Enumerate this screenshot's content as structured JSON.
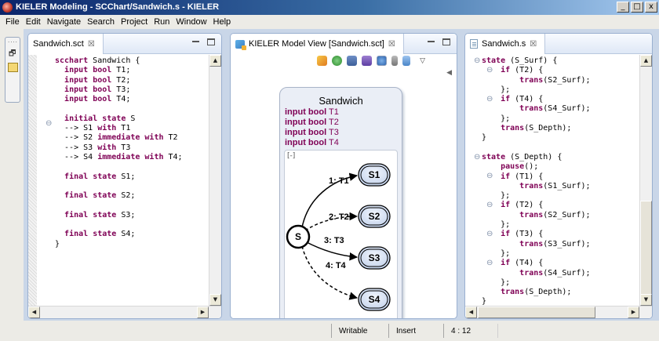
{
  "window": {
    "title": "KIELER Modeling - SCChart/Sandwich.s - KIELER",
    "controls": [
      "_",
      "□",
      "x"
    ]
  },
  "menu": [
    "File",
    "Edit",
    "Navigate",
    "Search",
    "Project",
    "Run",
    "Window",
    "Help"
  ],
  "left_editor": {
    "tab": "Sandwich.sct",
    "code_lines": [
      "scchart Sandwich {",
      "  input bool T1;",
      "  input bool T2;",
      "  input bool T3;",
      "  input bool T4;",
      "",
      "  initial state S",
      "  --> S1 with T1",
      "  --> S2 immediate with T2",
      "  --> S3 with T3",
      "  --> S4 immediate with T4;",
      "",
      "  final state S1;",
      "",
      "  final state S2;",
      "",
      "  final state S3;",
      "",
      "  final state S4;",
      "}"
    ]
  },
  "model_view": {
    "tab": "KIELER Model View [Sandwich.sct]",
    "toolbar_icons": [
      "sync-icon",
      "refresh-icon",
      "save-icon",
      "branch-icon",
      "settings-icon",
      "pin-icon",
      "link-icon",
      "menu-icon"
    ],
    "diagram": {
      "title": "Sandwich",
      "declarations": [
        {
          "kw": "input bool",
          "name": "T1"
        },
        {
          "kw": "input bool",
          "name": "T2"
        },
        {
          "kw": "input bool",
          "name": "T3"
        },
        {
          "kw": "input bool",
          "name": "T4"
        }
      ],
      "region_toggle": "[-]",
      "initial_state": "S",
      "states": [
        "S1",
        "S2",
        "S3",
        "S4"
      ],
      "transitions": [
        {
          "label": "1: T1",
          "to": "S1",
          "immediate": false
        },
        {
          "label": "2: T2",
          "to": "S2",
          "immediate": true
        },
        {
          "label": "3: T3",
          "to": "S3",
          "immediate": false
        },
        {
          "label": "4: T4",
          "to": "S4",
          "immediate": true
        }
      ]
    }
  },
  "right_editor": {
    "tab": "Sandwich.s",
    "code_lines": [
      "state (S_Surf) {",
      "    if (T2) {",
      "        trans(S2_Surf);",
      "    };",
      "    if (T4) {",
      "        trans(S4_Surf);",
      "    };",
      "    trans(S_Depth);",
      "}",
      "",
      "state (S_Depth) {",
      "    pause();",
      "    if (T1) {",
      "        trans(S1_Surf);",
      "    };",
      "    if (T2) {",
      "        trans(S2_Surf);",
      "    };",
      "    if (T3) {",
      "        trans(S3_Surf);",
      "    };",
      "    if (T4) {",
      "        trans(S4_Surf);",
      "    };",
      "    trans(S_Depth);",
      "}"
    ]
  },
  "status": {
    "writable": "Writable",
    "insert": "Insert",
    "position": "4 : 12"
  }
}
